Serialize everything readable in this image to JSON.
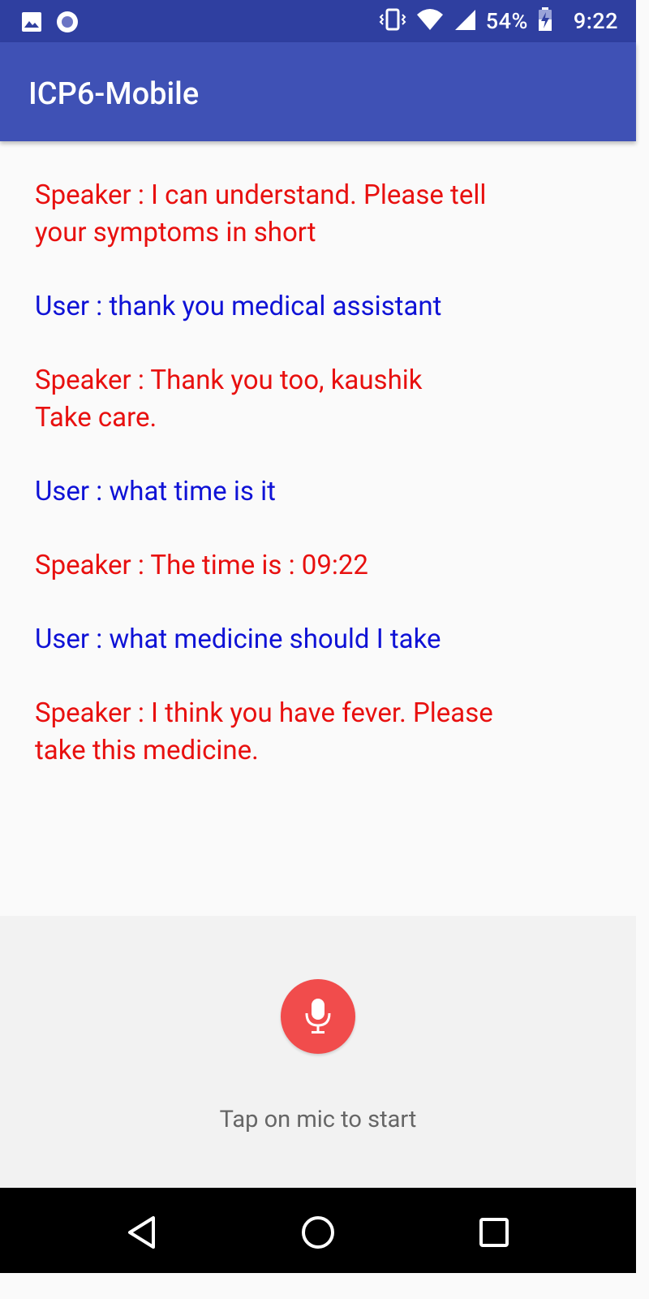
{
  "status_bar": {
    "battery": "54%",
    "time": "9:22",
    "icons": [
      "image-icon",
      "circle-notification-icon",
      "vibrate-icon",
      "wifi-icon",
      "cell-signal-icon",
      "battery-charging-icon"
    ]
  },
  "app_bar": {
    "title": "ICP6-Mobile"
  },
  "conversation": {
    "messages": [
      {
        "role": "speaker",
        "text": "Speaker : I can understand. Please tell\nyour symptoms in short"
      },
      {
        "role": "user",
        "text": "User : thank you medical assistant"
      },
      {
        "role": "speaker",
        "text": "Speaker : Thank you too, kaushik\nTake care."
      },
      {
        "role": "user",
        "text": "User : what time is it"
      },
      {
        "role": "speaker",
        "text": "Speaker : The time is : 09:22"
      },
      {
        "role": "user",
        "text": "User : what medicine should I take"
      },
      {
        "role": "speaker",
        "text": "Speaker : I think you have fever. Please\ntake this medicine."
      }
    ]
  },
  "mic": {
    "icon": "microphone-icon",
    "hint": "Tap on mic to start"
  },
  "nav_bar": {
    "icons": [
      "back-icon",
      "home-icon",
      "recents-icon"
    ]
  },
  "colors": {
    "status_bar": "#2f3fa0",
    "app_bar": "#3f51b5",
    "speaker_text": "#e8100f",
    "user_text": "#0f12d6",
    "mic_button": "#f14c4c"
  }
}
